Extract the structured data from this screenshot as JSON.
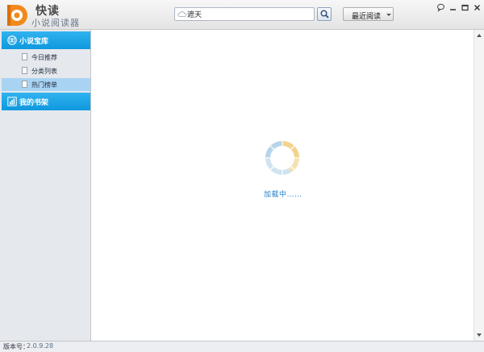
{
  "header": {
    "brand_line1": "快读",
    "brand_line2": "小说阅读器",
    "search": {
      "value": "遮天",
      "placeholder": ""
    },
    "recent_label": "最近阅读"
  },
  "sidebar": {
    "categories": [
      {
        "label": "小说宝库",
        "icon": "book-circle-icon"
      },
      {
        "label": "我的书架",
        "icon": "chart-bars-icon"
      }
    ],
    "items": [
      {
        "label": "今日推荐"
      },
      {
        "label": "分类列表"
      },
      {
        "label": "热门榜单",
        "active": true
      }
    ]
  },
  "main": {
    "loading_text": "加载中……"
  },
  "status": {
    "version_label": "版本号：",
    "version": "2.0.9.28"
  },
  "colors": {
    "accent": "#0e98de",
    "brand_orange": "#f08a1c",
    "active_item": "#a9d3f2"
  }
}
